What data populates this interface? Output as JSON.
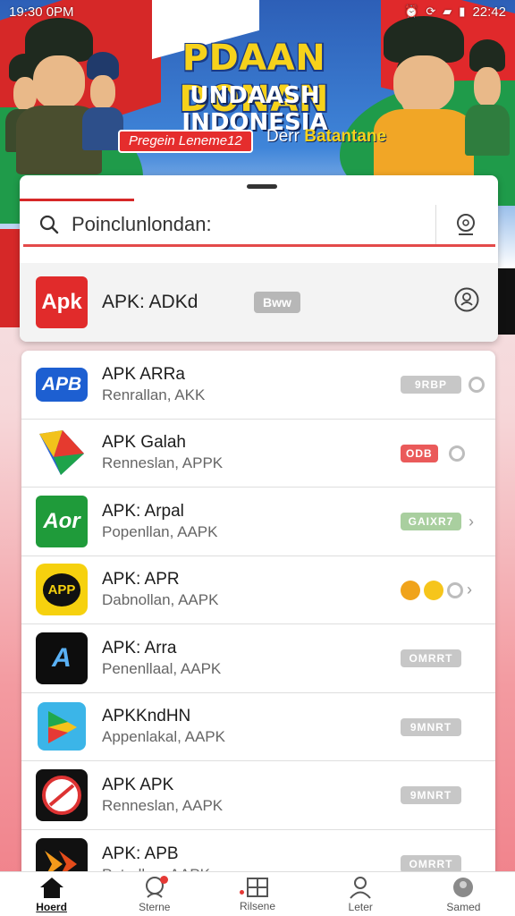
{
  "status_bar": {
    "time": "19:30 0PM",
    "clock_right": "22:42"
  },
  "banner": {
    "title": "PDAAN DONAN",
    "subtitle": "UNDAASH INDONESIA",
    "pill_text": "Pregein Leneme12",
    "tag_prefix": "Derr",
    "tag_highlight": "Batantane"
  },
  "search": {
    "placeholder": "Poinclunlondan:"
  },
  "featured": {
    "logo_text": "Apk",
    "name": "APK: ADKd",
    "badge": "Bww"
  },
  "apps": [
    {
      "logo": "APB",
      "name": "APK ARRa",
      "desc": "Renrallan, AKK",
      "tag": "9RBP"
    },
    {
      "logo": "",
      "name": "APK Galah",
      "desc": "Renneslan, APPK",
      "tag": "ODB"
    },
    {
      "logo": "Aor",
      "name": "APK: Arpal",
      "desc": "Popenllan, AAPK",
      "tag": "GAIXR7"
    },
    {
      "logo": "APP",
      "name": "APK: APR",
      "desc": "Dabnollan, AAPK",
      "tag": ""
    },
    {
      "logo": "A",
      "name": "APK: Arra",
      "desc": "Penenllaal, AAPK",
      "tag": "OMRRT"
    },
    {
      "logo": "",
      "name": "APKKndHN",
      "desc": "Appenlakal, AAPK",
      "tag": "9MNRT"
    },
    {
      "logo": "",
      "name": "APK APK",
      "desc": "Renneslan, AAPK",
      "tag": "9MNRT"
    },
    {
      "logo": "",
      "name": "APK: APB",
      "desc": "Paterllan, AAPK",
      "tag": "OMRRT"
    }
  ],
  "nav": [
    {
      "label": "Hoerd",
      "icon": "home-icon"
    },
    {
      "label": "Sterne",
      "icon": "profile-bell-icon"
    },
    {
      "label": "Rilsene",
      "icon": "grid-icon"
    },
    {
      "label": "Leter",
      "icon": "person-icon"
    },
    {
      "label": "Samed",
      "icon": "avatar-icon"
    }
  ],
  "colors": {
    "accent": "#d62828",
    "featured_logo_bg": "#e12b2b",
    "tag_gray": "#c7c7c7",
    "tag_red": "#ea5a5a",
    "tag_green": "#a9cf9f"
  }
}
